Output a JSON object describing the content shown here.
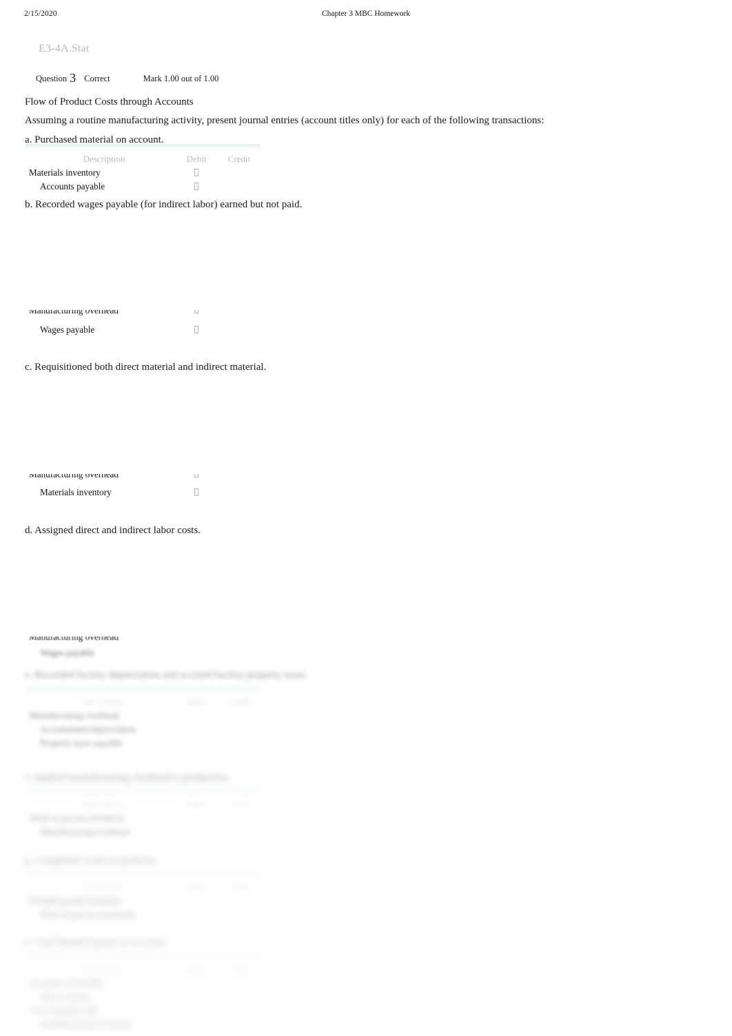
{
  "print_header": {
    "date": "2/15/2020",
    "title": "Chapter 3 MBC Homework"
  },
  "question": {
    "code": "E3-4A.Stat",
    "label": "Question",
    "number": "3",
    "state": "Correct",
    "mark": "Mark 1.00 out of 1.00"
  },
  "content": {
    "heading": "Flow of Product Costs through Accounts",
    "instruction": "Assuming a routine manufacturing activity, present journal entries (account titles only) for each of the following transactions:"
  },
  "table_headers": {
    "description": "Description",
    "debit": "Debit",
    "credit": "Credit"
  },
  "colors": {
    "header_band": "#dbe9ee",
    "muted_text": "#b9b9b9",
    "code_text": "#b7b7b7",
    "tofu_glyph": "#a8bcad",
    "body_text": "#1c1c1c"
  },
  "parts": [
    {
      "id": "a",
      "prompt": "a. Purchased material on account.",
      "rows": [
        {
          "description": "Materials inventory",
          "indent": false,
          "debit": "□",
          "credit": ""
        },
        {
          "description": "Accounts payable",
          "indent": true,
          "debit": "□",
          "credit": ""
        }
      ]
    },
    {
      "id": "b",
      "prompt": "b. Recorded wages payable (for indirect labor) earned but not paid.",
      "rows": [
        {
          "description": "Manufacturing overhead",
          "indent": false,
          "debit": "□",
          "credit": ""
        },
        {
          "description": "Wages payable",
          "indent": true,
          "debit": "□",
          "credit": ""
        }
      ]
    },
    {
      "id": "c",
      "prompt": "c. Requisitioned both direct material and indirect material.",
      "rows": [
        {
          "description": "Manufacturing overhead",
          "indent": false,
          "debit": "□",
          "credit": ""
        },
        {
          "description": "Materials inventory",
          "indent": true,
          "debit": "□",
          "credit": ""
        }
      ]
    },
    {
      "id": "d",
      "prompt": "d. Assigned direct and indirect labor costs.",
      "rows": [
        {
          "description": "Manufacturing overhead",
          "indent": false,
          "debit": "□",
          "credit": ""
        },
        {
          "description": "Wages payable",
          "indent": true,
          "debit": "",
          "credit": ""
        }
      ]
    }
  ],
  "blurred_parts": [
    {
      "id": "e",
      "prompt": "e. Recorded factory depreciation and accrued factory property taxes.",
      "rows": [
        {
          "description": "Manufacturing overhead",
          "indent": false,
          "debit": "",
          "credit": ""
        },
        {
          "description": "Accumulated depreciation",
          "indent": true,
          "debit": "",
          "credit": ""
        },
        {
          "description": "Property taxes payable",
          "indent": true,
          "debit": "",
          "credit": ""
        }
      ]
    },
    {
      "id": "f",
      "prompt": "f. Applied manufacturing overhead to production.",
      "rows": [
        {
          "description": "Work in process inventory",
          "indent": false,
          "debit": "",
          "credit": ""
        },
        {
          "description": "Manufacturing overhead",
          "indent": true,
          "debit": "",
          "credit": ""
        }
      ]
    },
    {
      "id": "g",
      "prompt": "g. Completed work on products.",
      "rows": [
        {
          "description": "Finished goods inventory",
          "indent": false,
          "debit": "",
          "credit": ""
        },
        {
          "description": "Work in process inventory",
          "indent": true,
          "debit": "",
          "credit": ""
        }
      ]
    },
    {
      "id": "h",
      "prompt": "h. Sold finished goods on account.",
      "rows": [
        {
          "description": "Accounts receivable",
          "indent": false,
          "debit": "",
          "credit": ""
        },
        {
          "description": "Sales revenue",
          "indent": true,
          "debit": "",
          "credit": ""
        },
        {
          "description": "Cost of goods sold",
          "indent": false,
          "debit": "",
          "credit": ""
        },
        {
          "description": "Finished goods inventory",
          "indent": true,
          "debit": "",
          "credit": ""
        }
      ]
    }
  ]
}
